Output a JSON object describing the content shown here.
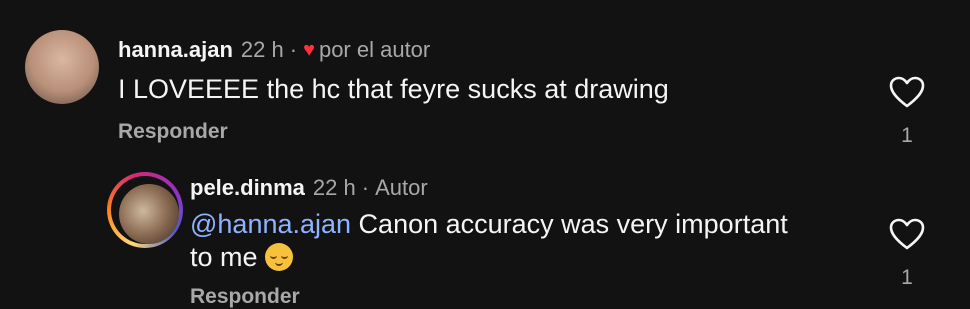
{
  "comments": [
    {
      "username": "hanna.ajan",
      "time": "22 h",
      "separator": "·",
      "liked_by_author_label": "por el autor",
      "text": "I LOVEEEE the hc that feyre sucks at drawing",
      "reply_label": "Responder",
      "like_count": "1"
    },
    {
      "username": "pele.dinma",
      "time": "22 h",
      "separator": "·",
      "author_badge": "Autor",
      "mention": "@hanna.ajan",
      "text_line1": " Canon accuracy was very important",
      "text_line2": "to me ",
      "emoji_icon": "relieved-face-emoji",
      "reply_label": "Responder",
      "like_count": "1"
    }
  ]
}
